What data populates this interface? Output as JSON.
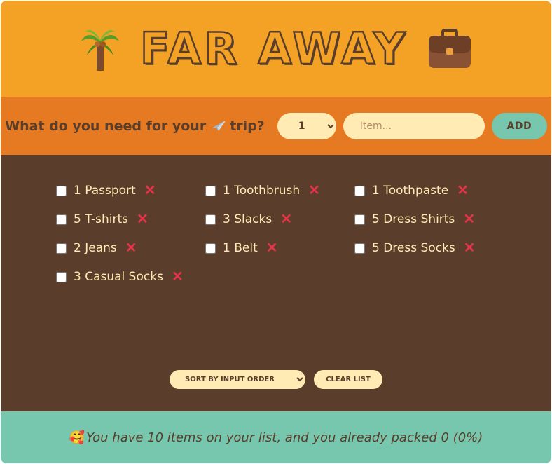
{
  "header": {
    "title": "FAR AWAY"
  },
  "add_form": {
    "question": "What do you need for your",
    "question_end": "trip?",
    "quantity_selected": "1",
    "item_placeholder": "Item...",
    "add_label": "ADD"
  },
  "items": [
    {
      "label": "1 Passport"
    },
    {
      "label": "1 Toothbrush"
    },
    {
      "label": "1 Toothpaste"
    },
    {
      "label": "5 T-shirts"
    },
    {
      "label": "3 Slacks"
    },
    {
      "label": "5 Dress Shirts"
    },
    {
      "label": "2 Jeans"
    },
    {
      "label": "1 Belt"
    },
    {
      "label": "5 Dress Socks"
    },
    {
      "label": "3 Casual Socks"
    }
  ],
  "actions": {
    "sort_selected": "SORT BY INPUT ORDER",
    "clear_label": "CLEAR LIST"
  },
  "footer": {
    "emoji": "🥰",
    "stats": "You have 10 items on your list, and you already packed 0 (0%)"
  },
  "colors": {
    "header_bg": "#f4a226",
    "form_bg": "#e57a22",
    "list_bg": "#5a3e2b",
    "footer_bg": "#76c7ad",
    "text_light": "#ffebb3",
    "delete": "#e5334a"
  },
  "icons": {
    "left": "palm-tree-icon",
    "right": "briefcase-icon",
    "plane": "airplane-icon",
    "delete": "cross-icon"
  }
}
